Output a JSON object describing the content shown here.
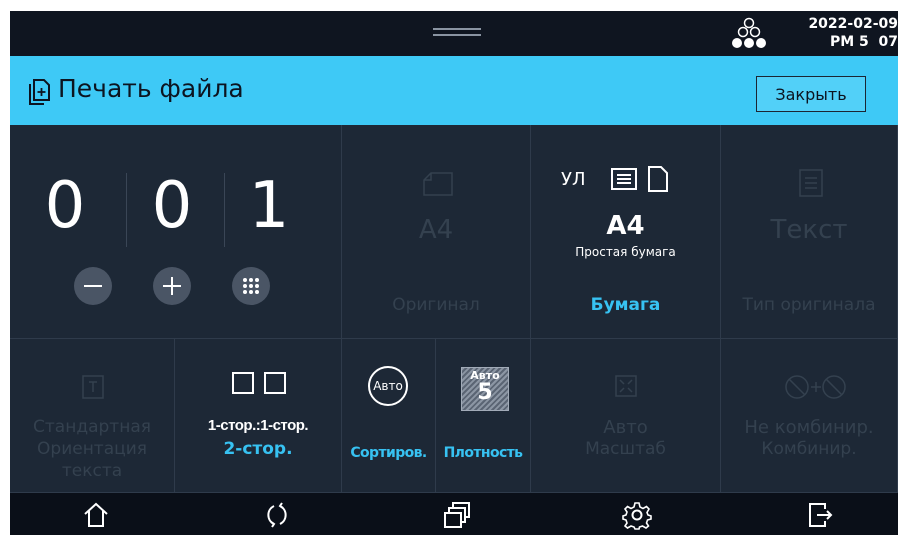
{
  "status": {
    "date": "2022-02-09",
    "time": "PM 5  07"
  },
  "title": {
    "text": "Печать файла",
    "close_label": "Закрыть"
  },
  "copies": {
    "digits": [
      "0",
      "0",
      "1"
    ]
  },
  "original": {
    "value": "A4",
    "label": "Оригинал"
  },
  "paper": {
    "tray": "УЛ",
    "size": "A4",
    "type": "Простая бумага",
    "label": "Бумага"
  },
  "original_type": {
    "value": "Текст",
    "label": "Тип оригинала"
  },
  "orientation": {
    "line1": "Стандартная",
    "line2": "Ориентация",
    "line3": "текста"
  },
  "duplex": {
    "value": "1-стор.:1-стор.",
    "label": "2-стор."
  },
  "sort": {
    "badge": "Авто",
    "label": "Сортиров."
  },
  "density": {
    "badge_top": "Авто",
    "badge_value": "5",
    "label": "Плотность"
  },
  "scale": {
    "value": "Авто",
    "label": "Масштаб"
  },
  "combine": {
    "value": "Не комбинир.",
    "label": "Комбинир."
  },
  "icons": {
    "home": "home-icon",
    "reset": "reset-icon",
    "jobs": "windows-icon",
    "settings": "gear-icon",
    "logout": "logout-icon"
  },
  "colors": {
    "accent": "#3ec9f6",
    "label_blue": "#37c2f2",
    "background": "#1d2836"
  }
}
